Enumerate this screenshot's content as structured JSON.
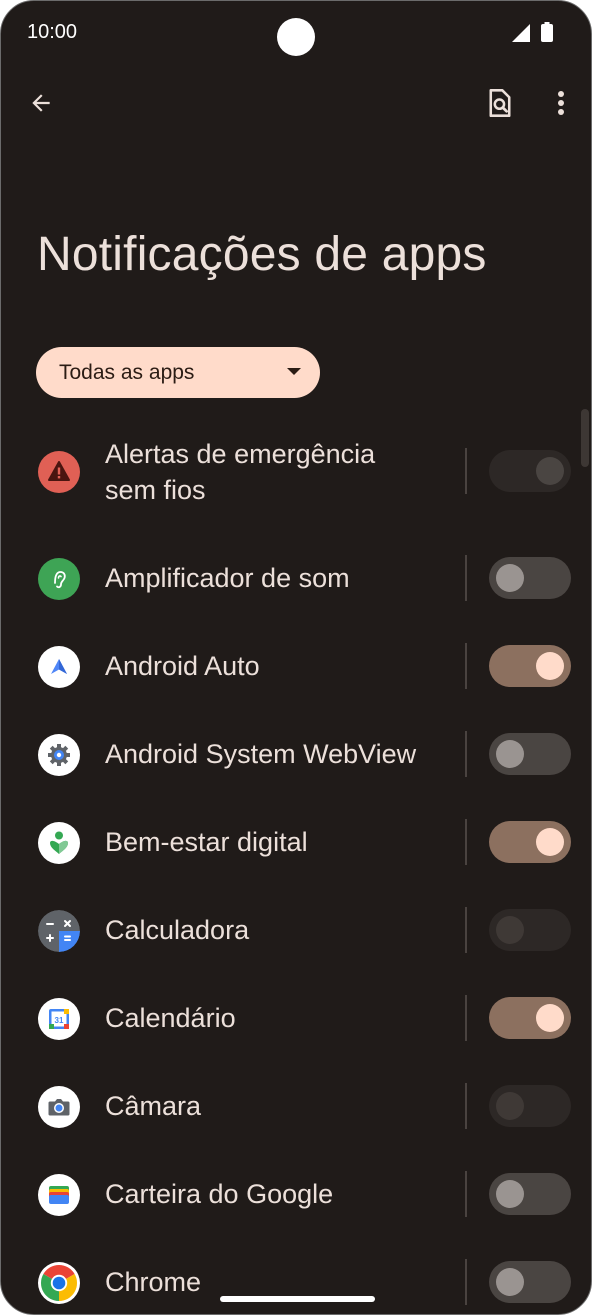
{
  "status_bar": {
    "time": "10:00",
    "signal_icon": "cell-signal-icon",
    "battery_icon": "battery-icon"
  },
  "top_bar": {
    "back_icon": "arrow-back-icon",
    "search_icon": "search-settings-icon",
    "more_icon": "more-vert-icon"
  },
  "page": {
    "title": "Notificações de apps"
  },
  "filter": {
    "label": "Todas as apps",
    "icon": "dropdown-arrow-icon"
  },
  "apps": [
    {
      "name": "Alertas de emergência sem fios",
      "line1": "Alertas de emergência",
      "line2": "sem fios",
      "icon": "emergency-alert-icon",
      "toggle": "on-disabled"
    },
    {
      "name": "Amplificador de som",
      "icon": "sound-amplifier-icon",
      "toggle": "off"
    },
    {
      "name": "Android Auto",
      "icon": "android-auto-icon",
      "toggle": "on"
    },
    {
      "name": "Android System WebView",
      "icon": "webview-gear-icon",
      "toggle": "off"
    },
    {
      "name": "Bem-estar digital",
      "icon": "digital-wellbeing-icon",
      "toggle": "on"
    },
    {
      "name": "Calculadora",
      "icon": "calculator-icon",
      "toggle": "off-disabled"
    },
    {
      "name": "Calendário",
      "icon": "calendar-icon",
      "calendar_day": "31",
      "toggle": "on"
    },
    {
      "name": "Câmara",
      "icon": "camera-icon",
      "toggle": "off-disabled"
    },
    {
      "name": "Carteira do Google",
      "icon": "google-wallet-icon",
      "toggle": "off"
    },
    {
      "name": "Chrome",
      "icon": "chrome-icon",
      "toggle": "off"
    }
  ],
  "colors": {
    "background": "#201b19",
    "text": "#ece0da",
    "filter_chip": "#ffdbca",
    "switch_on_track": "#8c705f",
    "switch_on_thumb": "#ffdbca",
    "switch_off_track": "#4a4542",
    "switch_off_thumb": "#9a9491"
  }
}
